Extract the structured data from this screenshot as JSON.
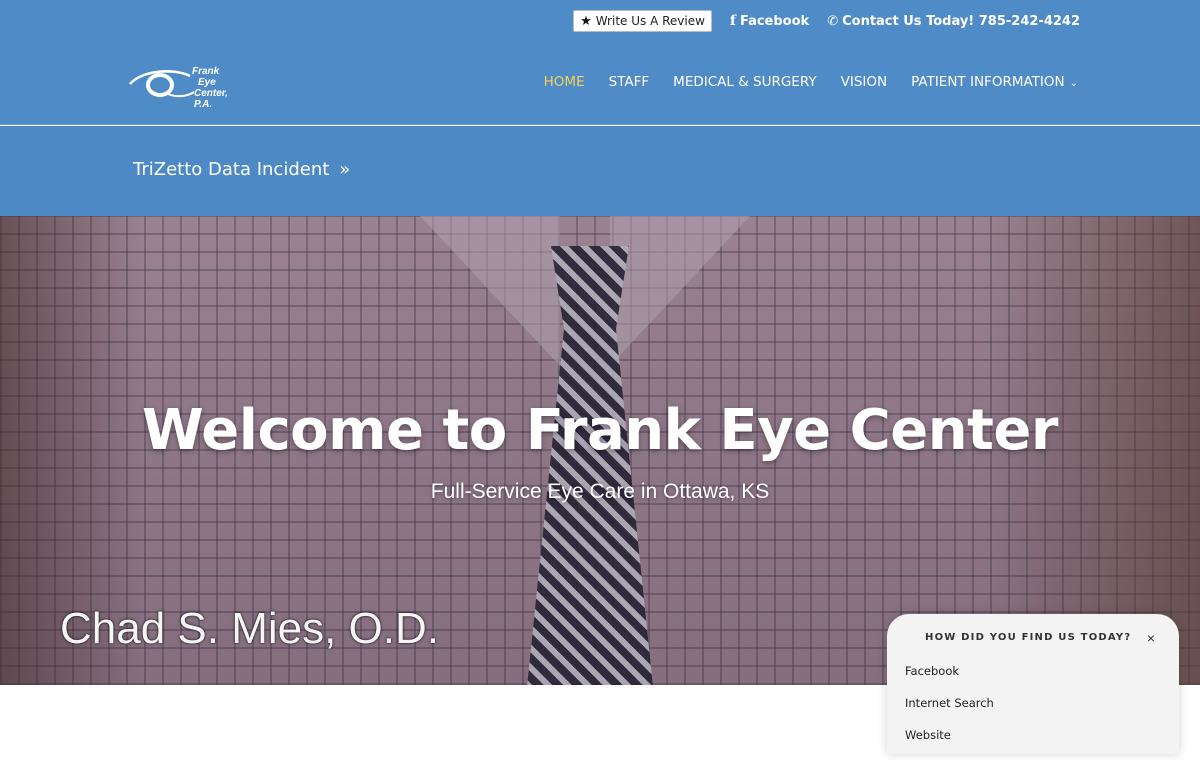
{
  "topbar": {
    "review_label": "Write Us A Review",
    "facebook_label": "Facebook",
    "contact_label": "Contact Us Today! 785-242-4242"
  },
  "logo": {
    "line1": "Frank",
    "line2": "Eye",
    "line3": "Center, P.A."
  },
  "nav": {
    "items": [
      {
        "label": "HOME",
        "active": true
      },
      {
        "label": "STAFF"
      },
      {
        "label": "MEDICAL & SURGERY"
      },
      {
        "label": "VISION"
      },
      {
        "label": "PATIENT INFORMATION",
        "has_dropdown": true
      }
    ]
  },
  "banner": {
    "link_label": "TriZetto Data Incident",
    "arrow": "»"
  },
  "hero": {
    "title": "Welcome to Frank Eye Center",
    "subtitle": "Full-Service Eye Care in Ottawa, KS",
    "caption": "Chad S. Mies, O.D."
  },
  "survey": {
    "question": "HOW DID YOU FIND US TODAY?",
    "close_glyph": "×",
    "options": [
      "Facebook",
      "Internet Search",
      "Website"
    ]
  },
  "colors": {
    "header_bg": "#4f8bc7",
    "nav_active": "#f3d35a",
    "text_light": "#ffffff"
  },
  "icons": {
    "review": "star-icon",
    "facebook": "facebook-icon",
    "contact": "phone-icon",
    "dropdown": "chevron-down-icon",
    "close": "close-icon"
  }
}
